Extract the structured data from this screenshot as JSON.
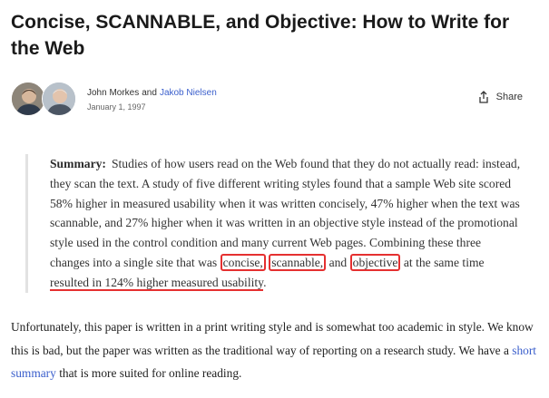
{
  "article": {
    "title": "Concise, SCANNABLE, and Objective: How to Write for the Web",
    "authors": {
      "author1": "John Morkes",
      "joiner": "and",
      "author2": "Jakob Nielsen"
    },
    "date": "January 1, 1997",
    "share_label": "Share"
  },
  "summary": {
    "label": "Summary:",
    "text_1": "Studies of how users read on the Web found that they do not actually read: instead, they scan the text. A study of five different writing styles found that a sample Web site scored 58% higher in measured usability when it was written concisely, 47% higher when the text was scannable, and 27% higher when it was written in an objective style instead of the promotional style used in the control condition and many current Web pages. Combining these three changes into a single site that was ",
    "hl_concise": "concise,",
    "text_2": " ",
    "hl_scannable": "scannable,",
    "text_3": " and ",
    "hl_objective": "objective",
    "text_4": " at the same time ",
    "hl_result": "resulted in 124% higher measured usability",
    "text_5": "."
  },
  "body": {
    "text_1": "Unfortunately, this paper is written in a print writing style and is somewhat too academic in style. We know this is bad, but the paper was written as the traditional way of reporting on a research study. We have a ",
    "link": "short summary",
    "text_2": " that is more suited for online reading."
  },
  "colors": {
    "annotation": "#e53030",
    "link": "#3b5fcc"
  },
  "icons": {
    "share": "share-icon"
  }
}
